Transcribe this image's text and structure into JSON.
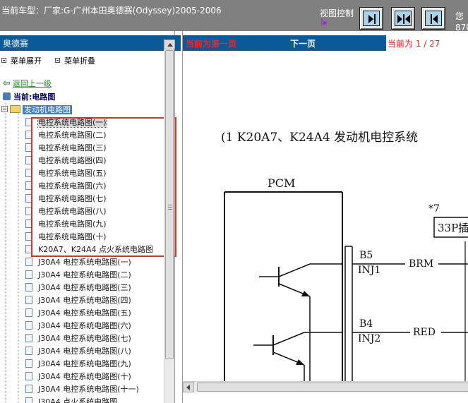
{
  "header": {
    "vehicle_title": "当前车型：厂家:G-广州本田奥德赛(Odyssey)2005-2006",
    "view_control_label": "视图控制",
    "view_control_arrow": "I▸",
    "right_text_1": "您",
    "right_text_2": "870"
  },
  "left_panel": {
    "title": "奥德赛",
    "menu_expand": "菜单展开",
    "menu_collapse": "菜单折叠",
    "back_link": "返回上一级",
    "current_label": "当前:电路图",
    "folder_label": "发动机电路图",
    "items": [
      "电控系统电路图(一)",
      "电控系统电路图(二)",
      "电控系统电路图(三)",
      "电控系统电路图(四)",
      "电控系统电路图(五)",
      "电控系统电路图(六)",
      "电控系统电路图(七)",
      "电控系统电路图(八)",
      "电控系统电路图(九)",
      "电控系统电路图(十)",
      "K20A7、K24A4 点火系统电路图",
      "J30A4 电控系统电路图(一)",
      "J30A4 电控系统电路图(二)",
      "J30A4 电控系统电路图(三)",
      "J30A4 电控系统电路图(四)",
      "J30A4 电控系统电路图(五)",
      "J30A4 电控系统电路图(六)",
      "J30A4 电控系统电路图(七)",
      "J30A4 电控系统电路图(八)",
      "J30A4 电控系统电路图(九)",
      "J30A4 电控系统电路图(十)",
      "J30A4 电控系统电路图(十一)",
      "J30A4 点火系统电路图"
    ]
  },
  "nav": {
    "current_first": "当前为第一页",
    "next_page": "下一页",
    "page_indicator": "当前为 1 / 27"
  },
  "diagram": {
    "title": "(1  K20A7、K24A4 发动机电控系统",
    "pcm": "PCM",
    "note": "*7",
    "connector": "33P插",
    "pin1": "B5",
    "pin1_name": "INJ1",
    "wire1": "BRM",
    "pin2": "B4",
    "pin2_name": "INJ2",
    "wire2": "RED"
  }
}
